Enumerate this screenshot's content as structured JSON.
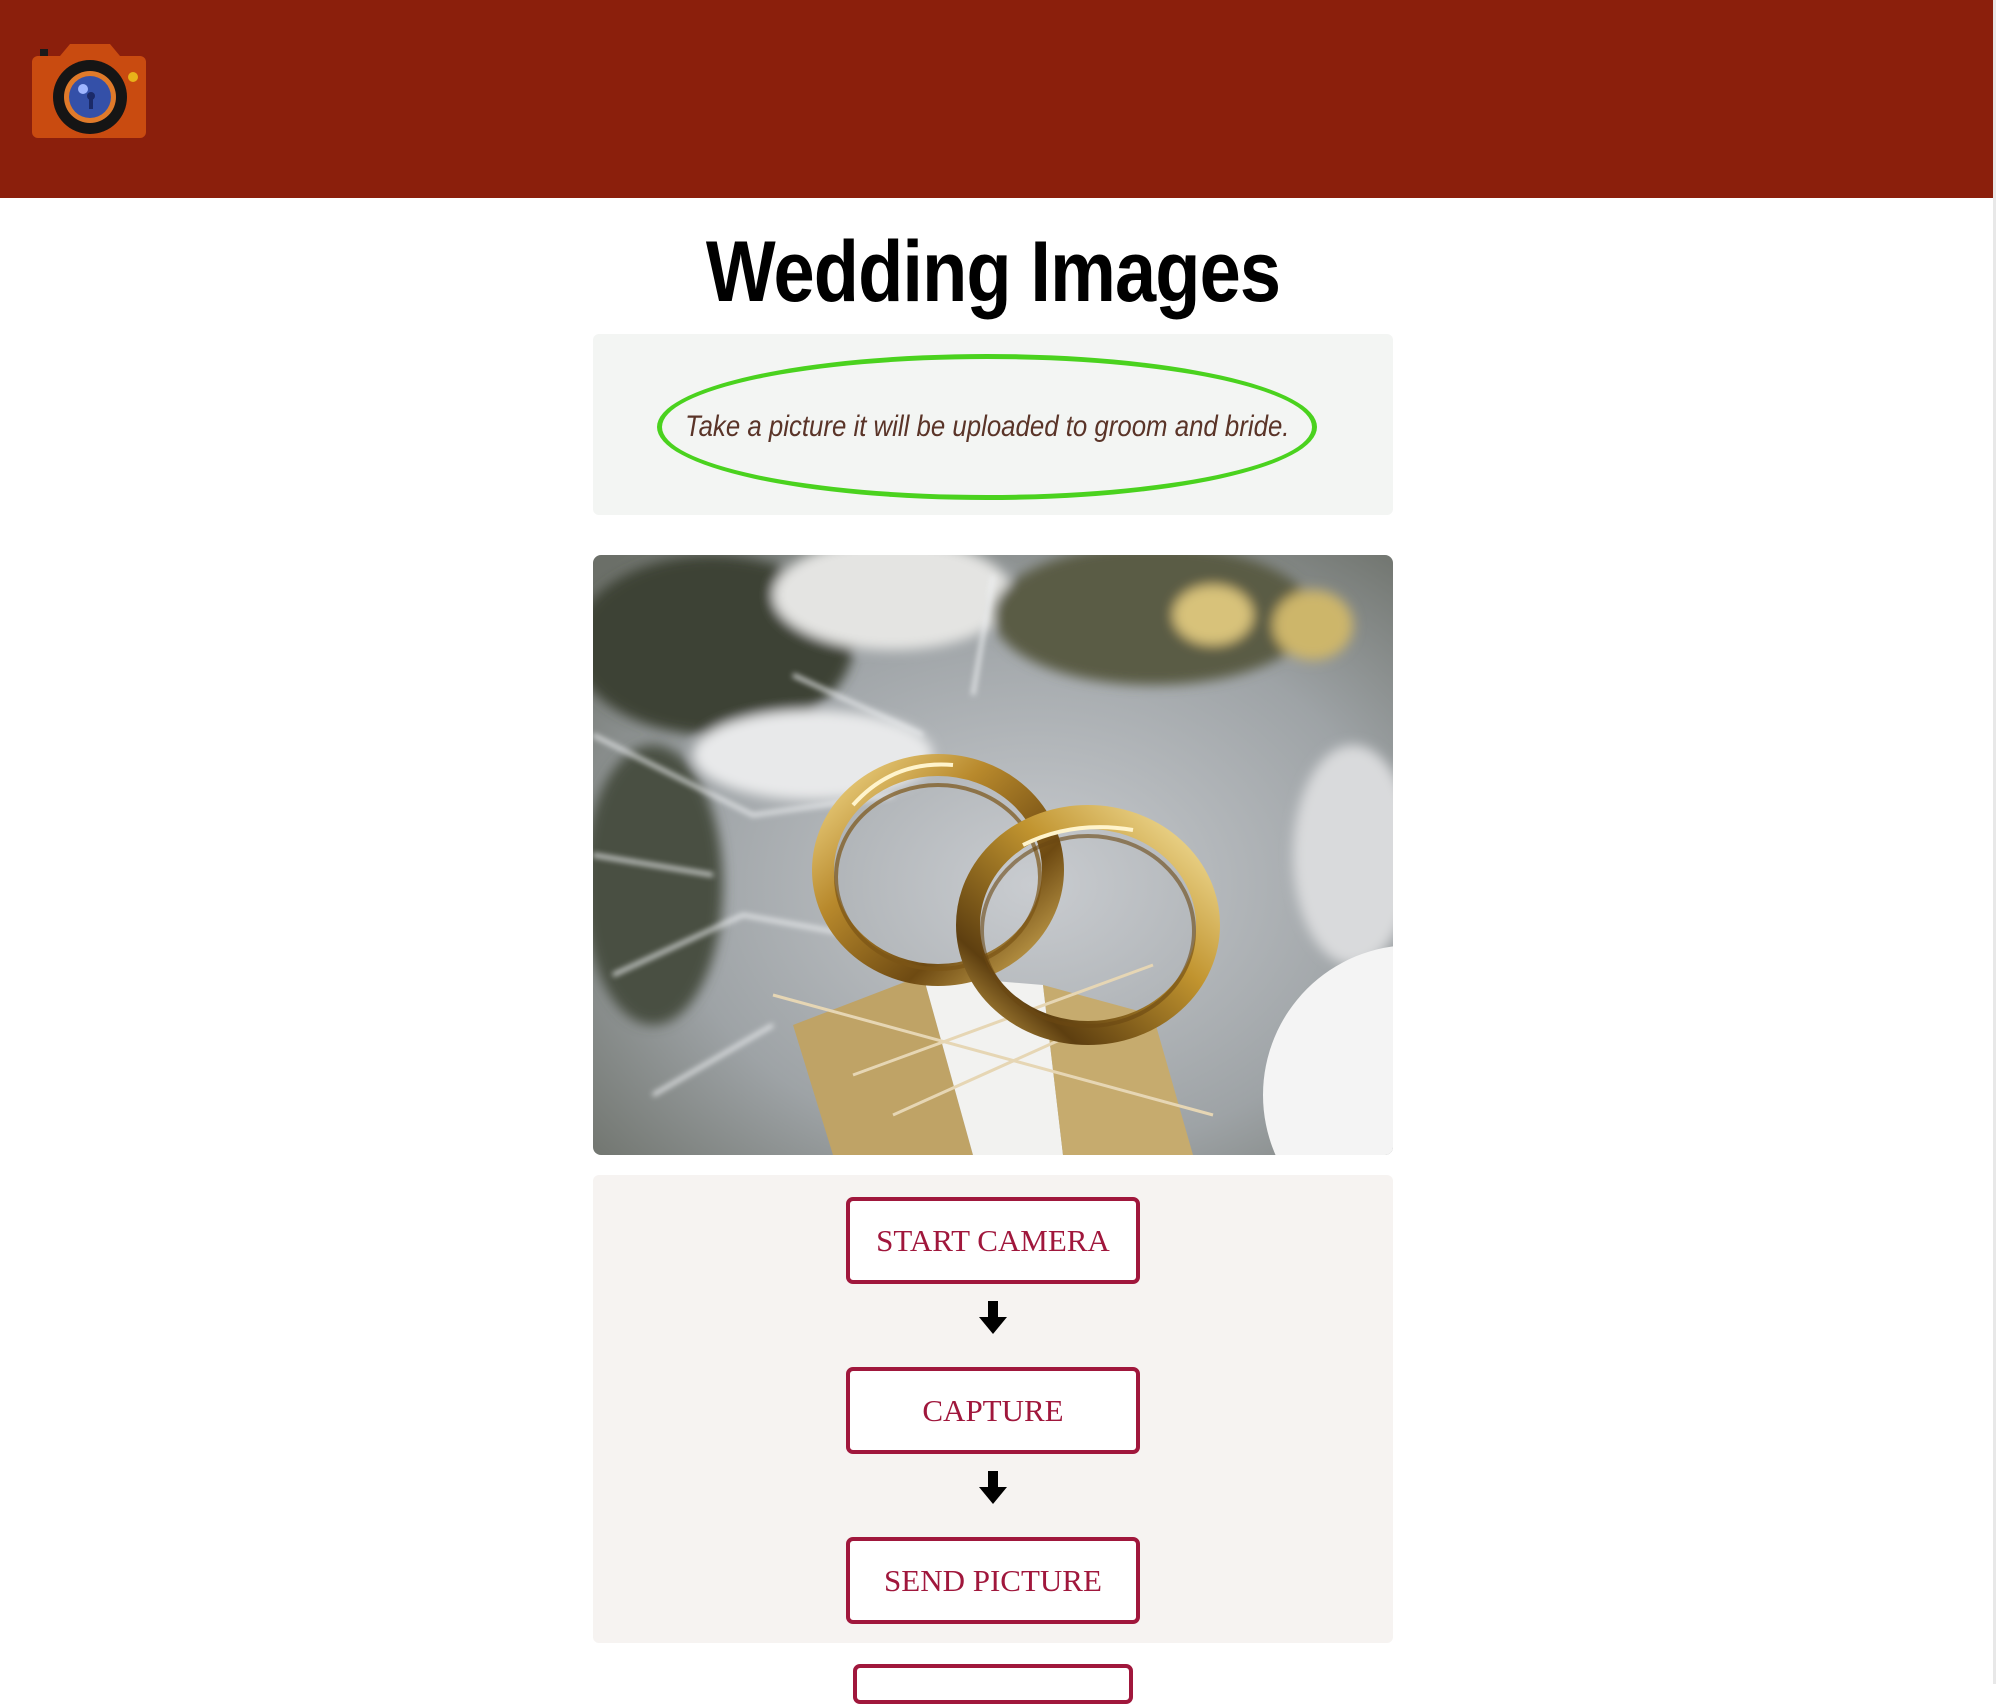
{
  "header": {
    "logo_icon": "camera-icon",
    "background_color": "#8b1f0c"
  },
  "main": {
    "title": "Wedding Images",
    "instruction": "Take a picture it will be uploaded to groom and bride.",
    "photo_icon": "wedding-rings-photo"
  },
  "controls": {
    "start_camera_label": "START CAMERA",
    "capture_label": "CAPTURE",
    "send_picture_label": "SEND PICTURE",
    "arrow_icon": "arrow-down-icon",
    "accent_color": "#a0173c"
  },
  "colors": {
    "ellipse_border": "#4ad21e",
    "instruction_text": "#5a3428"
  }
}
